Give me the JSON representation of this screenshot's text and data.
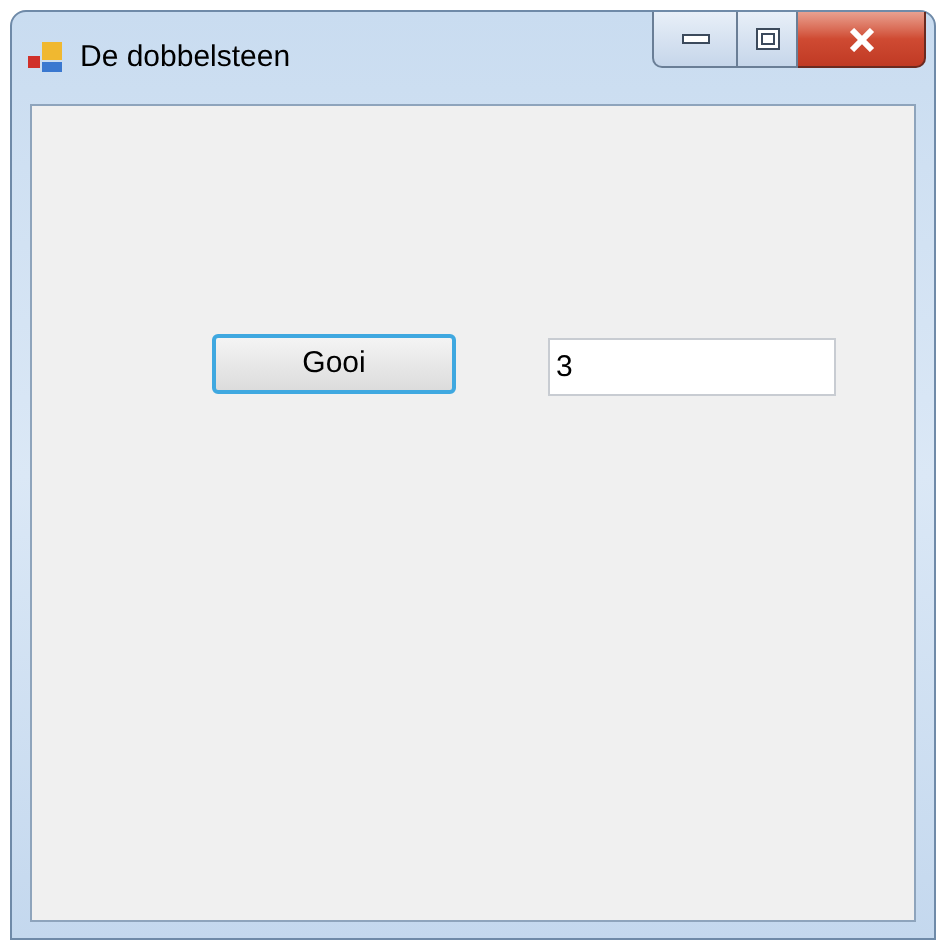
{
  "window": {
    "title": "De dobbelsteen"
  },
  "form": {
    "button": "Gooi",
    "result": "3"
  }
}
